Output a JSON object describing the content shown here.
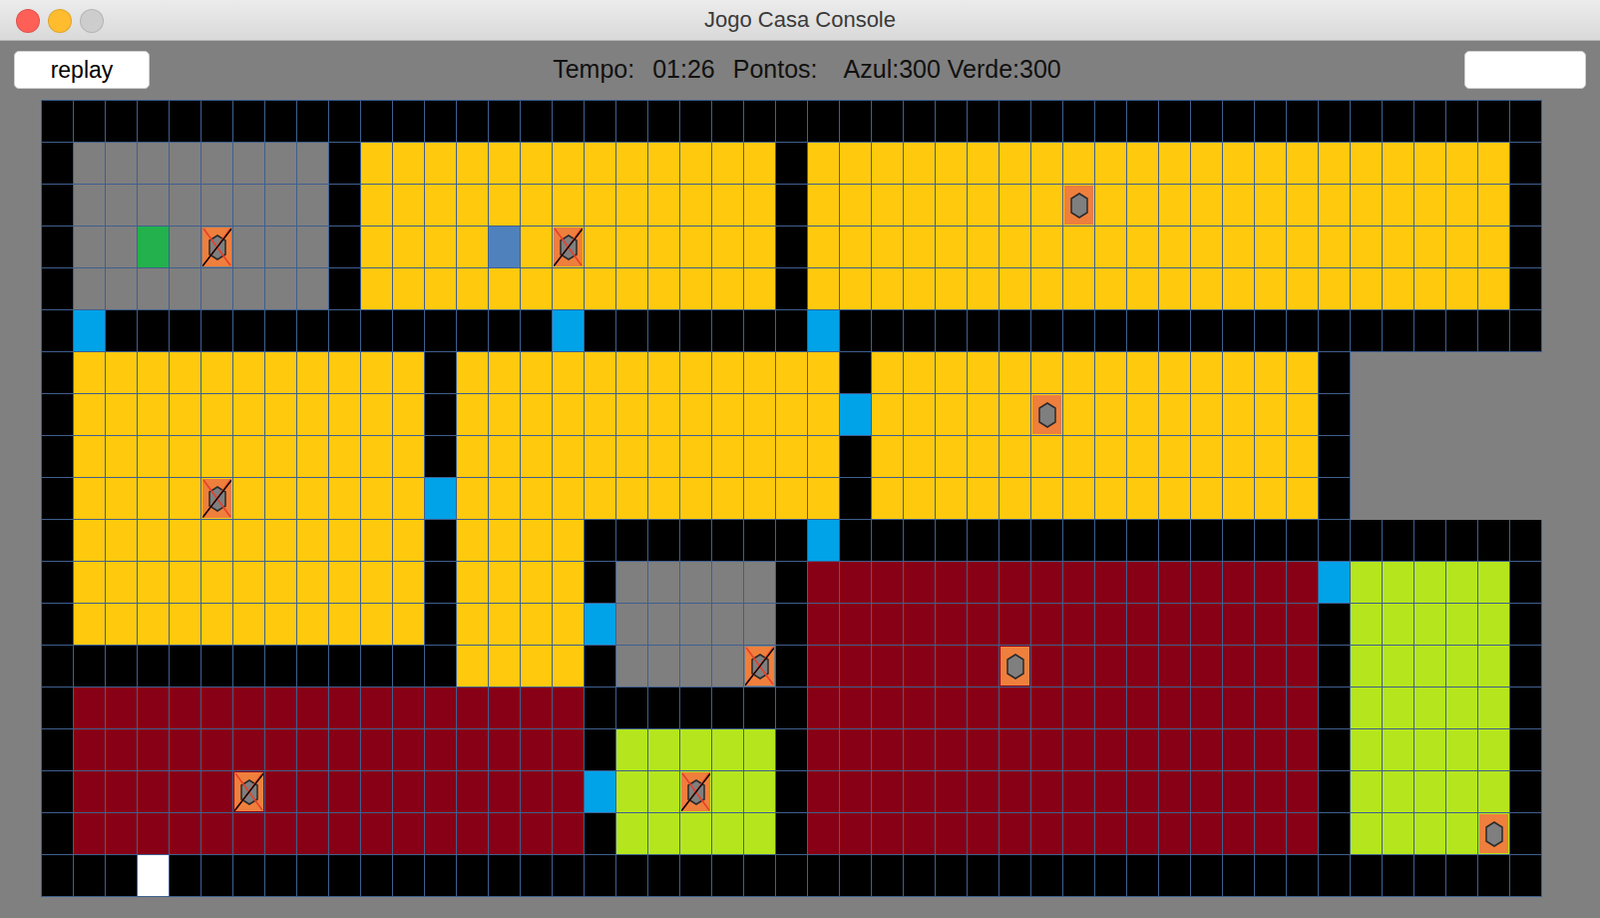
{
  "window": {
    "title": "Jogo Casa Console",
    "controls": [
      {
        "kind": "close",
        "disabled": false
      },
      {
        "kind": "minimize",
        "disabled": false
      },
      {
        "kind": "zoom",
        "disabled": true
      }
    ]
  },
  "toolbar": {
    "button": "replay",
    "time_label": "Tempo:",
    "time": "01:26",
    "points_label": "Pontos:",
    "score": "Azul:300 Verde:300",
    "field": ""
  },
  "board": {
    "legend": {
      "W": {
        "kind": "wall",
        "color": "#000000"
      },
      "G": {
        "kind": "gray-room",
        "color": "#7f7f7f"
      },
      "Y": {
        "kind": "yellow-room",
        "color": "#ffc90e"
      },
      "D": {
        "kind": "door",
        "color": "#00a2e8"
      },
      "R": {
        "kind": "red-room",
        "color": "#880015"
      },
      "L": {
        "kind": "green-room",
        "color": "#b5e61d"
      },
      "X": {
        "kind": "exit",
        "color": "#ffffff"
      },
      ".": {
        "kind": "empty",
        "color": "#808080"
      }
    },
    "rows": [
      "WWWWWWWWWWWWWWWWWWWWWWWWWWWWWWWWWWWWWWWWWWWWWWW",
      "WGGGGGGGGWYYYYYYYYYYYYYWYYYYYYYYYYYYYYYYYYYYYYW",
      "WGGGGGGGGWYYYYYYYYYYYYYWYYYYYYYYYYYYYYYYYYYYYYW",
      "WGGGGGGGGWYYYYYYYYYYYYYWYYYYYYYYYYYYYYYYYYYYYYW",
      "WGGGGGGGGWYYYYYYYYYYYYYWYYYYYYYYYYYYYYYYYYYYYYW",
      "WDWWWWWWWWWWWWWWDWWWWWWWDWWWWWWWWWWWWWWWWWWWWWW",
      "WYYYYYYYYYYYWYYYYYYYYYYYYWYYYYYYYYYYYYYYW......",
      "WYYYYYYYYYYYWYYYYYYYYYYYYDYYYYYYYYYYYYYYW......",
      "WYYYYYYYYYYYWYYYYYYYYYYYYWYYYYYYYYYYYYYYW......",
      "WYYYYYYYYYYYDYYYYYYYYYYYYWYYYYYYYYYYYYYYW......",
      "WYYYYYYYYYYYWYYYYWWWWWWWDWWWWWWWWWWWWWWWWWWWWWW",
      "WYYYYYYYYYYYWYYYYWGGGGGWRRRRRRRRRRRRRRRRDLLLLLW",
      "WYYYYYYYYYYYWYYYYDGGGGGWRRRRRRRRRRRRRRRRWLLLLLW",
      "WWWWWWWWWWWWWYYYYWGGGGGWRRRRRRRRRRRRRRRRWLLLLLW",
      "WRRRRRRRRRRRRRRRRWWWWWWWRRRRRRRRRRRRRRRRWLLLLLW",
      "WRRRRRRRRRRRRRRRRWLLLLLWRRRRRRRRRRRRRRRRWLLLLLW",
      "WRRRRRRRRRRRRRRRRDLLLLLWRRRRRRRRRRRRRRRRWLLLLLW",
      "WRRRRRRRRRRRRRRRRWLLLLLWRRRRRRRRRRRRRRRRWLLLLLW",
      "WWWXWWWWWWWWWWWWWWWWWWWWWWWWWWWWWWWWWWWWWWWWWWW"
    ]
  },
  "players": [
    {
      "row": 3,
      "col": 14,
      "color": "#4f81bd"
    },
    {
      "row": 3,
      "col": 3,
      "color": "#22b14c"
    }
  ],
  "pieces": [
    {
      "row": 3,
      "col": 5,
      "collected": true
    },
    {
      "row": 3,
      "col": 16,
      "collected": true
    },
    {
      "row": 2,
      "col": 32,
      "collected": false
    },
    {
      "row": 7,
      "col": 31,
      "collected": false
    },
    {
      "row": 9,
      "col": 5,
      "collected": true
    },
    {
      "row": 13,
      "col": 22,
      "collected": true
    },
    {
      "row": 13,
      "col": 30,
      "collected": false
    },
    {
      "row": 16,
      "col": 6,
      "collected": true
    },
    {
      "row": 16,
      "col": 20,
      "collected": true
    },
    {
      "row": 17,
      "col": 45,
      "collected": false
    }
  ]
}
